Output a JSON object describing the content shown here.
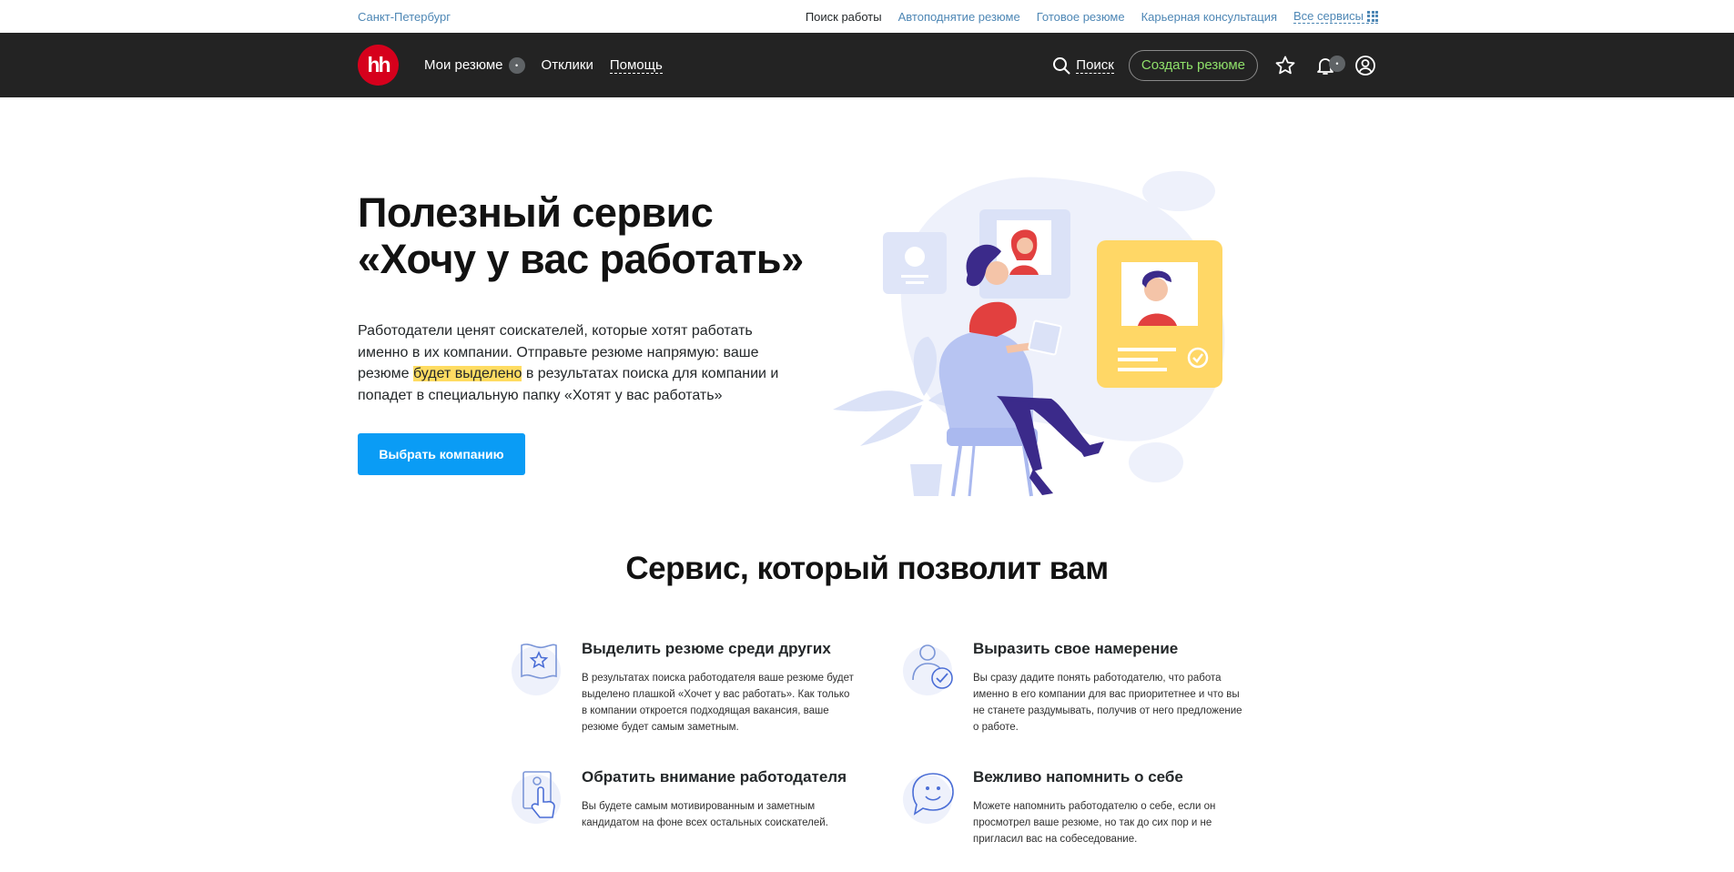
{
  "topbar": {
    "city": "Санкт-Петербург",
    "links": [
      "Поиск работы",
      "Автоподнятие резюме",
      "Готовое резюме",
      "Карьерная консультация"
    ],
    "all_services": "Все сервисы"
  },
  "navbar": {
    "logo": "hh",
    "my_resumes": "Мои резюме",
    "my_resumes_badge": "•",
    "responses": "Отклики",
    "help": "Помощь",
    "search": "Поиск",
    "create_resume": "Создать резюме",
    "bell_badge": "•",
    "icons": [
      "search-icon",
      "star-icon",
      "bell-icon",
      "user-icon"
    ]
  },
  "hero": {
    "title_line1": "Полезный сервис",
    "title_line2": "«Хочу у вас работать»",
    "text_before": "Работодатели ценят соискателей, которые хотят работать именно в их компании. Отправьте резюме напрямую: ваше резюме ",
    "text_highlight": "будет выделено",
    "text_after": " в результатах поиска для компании и попадет в специальную папку «Хотят у вас работать»",
    "button": "Выбрать компанию"
  },
  "section": {
    "title": "Сервис, который позволит вам",
    "features": [
      {
        "icon": "flag-star-icon",
        "title": "Выделить резюме среди других",
        "text": "В результатах поиска работодателя ваше резюме будет выделено плашкой «Хочет у вас работать». Как только в компании откроется подходящая вакансия, ваше резюме будет самым заметным."
      },
      {
        "icon": "person-check-icon",
        "title": "Выразить свое намерение",
        "text": "Вы сразу дадите понять работодателю, что работа именно в его компании для вас приоритетнее и что вы не станете раздумывать, получив от него предложение о работе."
      },
      {
        "icon": "hand-pointer-icon",
        "title": "Обратить внимание работодателя",
        "text": "Вы будете самым мотивированным и заметным кандидатом на фоне всех остальных соискателей."
      },
      {
        "icon": "smile-chat-icon",
        "title": "Вежливо напомнить о себе",
        "text": "Можете напомнить работодателю о себе, если он просмотрел ваше резюме, но так до сих пор и не пригласил вас на собеседование."
      }
    ]
  },
  "colors": {
    "brand_red": "#d6001c",
    "nav_bg": "#232323",
    "link_blue": "#4e87b5",
    "button_blue": "#0a9cf5",
    "highlight": "#ffdc62",
    "create_green": "#8fe06a"
  }
}
